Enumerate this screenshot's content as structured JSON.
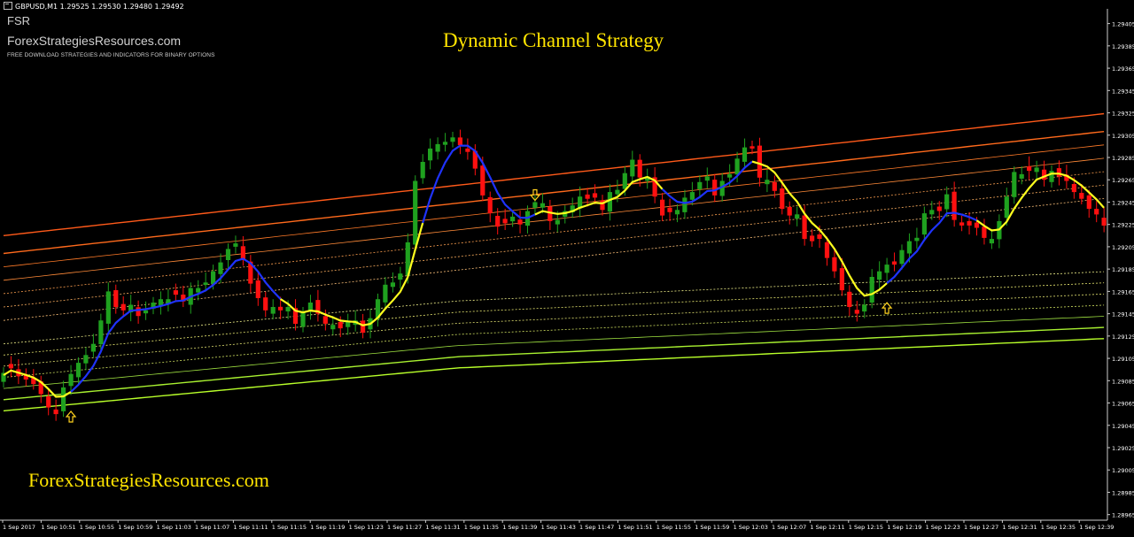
{
  "header": {
    "symbol_line": "GBPUSD,M1  1.29525 1.29530 1.29480 1.29492"
  },
  "branding": {
    "short_name": "FSR",
    "site": "ForexStrategiesResources.com",
    "tagline": "FREE DOWNLOAD STRATEGIES AND INDICATORS FOR BINARY OPTIONS",
    "footer_site": "ForexStrategiesResources.com"
  },
  "colors": {
    "background": "#000000",
    "bull": "#1fa11f",
    "bear": "#ff1010",
    "wma_up": "#1f33ff",
    "wma_down": "#ffff1e",
    "upper_channel": "#ff5a1a",
    "lower_channel": "#b8ff2a",
    "title": "#ffe400",
    "arrow": "#ffd21e"
  },
  "chart_data": {
    "type": "candlestick",
    "title": "Dynamic Channel Strategy",
    "timeframe": "M1",
    "ylim": [
      1.2896,
      1.29415
    ],
    "y_ticks": [
      "1.29405",
      "1.29385",
      "1.29365",
      "1.29345",
      "1.29325",
      "1.29305",
      "1.29285",
      "1.29265",
      "1.29245",
      "1.29225",
      "1.29205",
      "1.29185",
      "1.29165",
      "1.29145",
      "1.29125",
      "1.29105",
      "1.29085",
      "1.29065",
      "1.29045",
      "1.29025",
      "1.29005",
      "1.28985",
      "1.28965"
    ],
    "x_ticks": [
      "1 Sep 2017",
      "1 Sep 10:51",
      "1 Sep 10:55",
      "1 Sep 10:59",
      "1 Sep 11:03",
      "1 Sep 11:07",
      "1 Sep 11:11",
      "1 Sep 11:15",
      "1 Sep 11:19",
      "1 Sep 11:23",
      "1 Sep 11:27",
      "1 Sep 11:31",
      "1 Sep 11:35",
      "1 Sep 11:39",
      "1 Sep 11:43",
      "1 Sep 11:47",
      "1 Sep 11:51",
      "1 Sep 11:55",
      "1 Sep 11:59",
      "1 Sep 12:03",
      "1 Sep 12:07",
      "1 Sep 12:11",
      "1 Sep 12:15",
      "1 Sep 12:19",
      "1 Sep 12:23",
      "1 Sep 12:27",
      "1 Sep 12:31",
      "1 Sep 12:35",
      "1 Sep 12:39"
    ],
    "candle_count": 148,
    "closes": [
      1.29092,
      1.29096,
      1.29089,
      1.29086,
      1.29082,
      1.29073,
      1.29061,
      1.29055,
      1.29079,
      1.29091,
      1.29101,
      1.29108,
      1.29118,
      1.29139,
      1.29165,
      1.29151,
      1.29148,
      1.29153,
      1.29143,
      1.29148,
      1.29155,
      1.29158,
      1.29158,
      1.29162,
      1.29156,
      1.29168,
      1.29168,
      1.29173,
      1.29183,
      1.29191,
      1.29203,
      1.29208,
      1.29193,
      1.29172,
      1.29159,
      1.29148,
      1.29151,
      1.29148,
      1.29151,
      1.29136,
      1.29146,
      1.29155,
      1.29145,
      1.29136,
      1.29135,
      1.29132,
      1.29138,
      1.29139,
      1.29128,
      1.29141,
      1.29158,
      1.29171,
      1.29173,
      1.29181,
      1.29209,
      1.29264,
      1.29281,
      1.29293,
      1.29297,
      1.29299,
      1.29303,
      1.29296,
      1.2929,
      1.29275,
      1.29251,
      1.29235,
      1.29223,
      1.29226,
      1.29232,
      1.29225,
      1.29237,
      1.29245,
      1.29244,
      1.29228,
      1.29229,
      1.29237,
      1.29242,
      1.2925,
      1.29248,
      1.29249,
      1.29238,
      1.29254,
      1.29256,
      1.29271,
      1.29283,
      1.29267,
      1.29268,
      1.2925,
      1.29233,
      1.29236,
      1.29238,
      1.29249,
      1.29254,
      1.29263,
      1.29268,
      1.29251,
      1.29264,
      1.2927,
      1.29284,
      1.29294,
      1.29293,
      1.29267,
      1.29265,
      1.29255,
      1.29239,
      1.29233,
      1.29234,
      1.29212,
      1.2921,
      1.29212,
      1.29195,
      1.29183,
      1.29166,
      1.29151,
      1.29145,
      1.29153,
      1.29178,
      1.29183,
      1.29189,
      1.29189,
      1.29202,
      1.2921,
      1.29213,
      1.29235,
      1.29238,
      1.29237,
      1.29252,
      1.29229,
      1.29224,
      1.29224,
      1.29222,
      1.29213,
      1.29212,
      1.29228,
      1.2925,
      1.29272,
      1.2927,
      1.29273,
      1.29276,
      1.29265,
      1.29273,
      1.29268,
      1.29264,
      1.29254,
      1.29248,
      1.29239,
      1.29234,
      1.29224
    ],
    "wma_start_price": 1.2909,
    "wma_direction_segments": [
      {
        "from": 0,
        "to": 9,
        "dir": "down"
      },
      {
        "from": 9,
        "to": 37,
        "dir": "up"
      },
      {
        "from": 37,
        "to": 56,
        "dir": "down"
      },
      {
        "from": 56,
        "to": 71,
        "dir": "up"
      },
      {
        "from": 71,
        "to": 88,
        "dir": "down"
      },
      {
        "from": 88,
        "to": 100,
        "dir": "up"
      },
      {
        "from": 100,
        "to": 118,
        "dir": "down"
      },
      {
        "from": 118,
        "to": 130,
        "dir": "up"
      },
      {
        "from": 130,
        "to": 147,
        "dir": "down"
      }
    ],
    "signal_arrows": [
      {
        "type": "buy",
        "candle": 9
      },
      {
        "type": "sell",
        "candle": 71
      },
      {
        "type": "buy",
        "candle": 118
      }
    ]
  }
}
